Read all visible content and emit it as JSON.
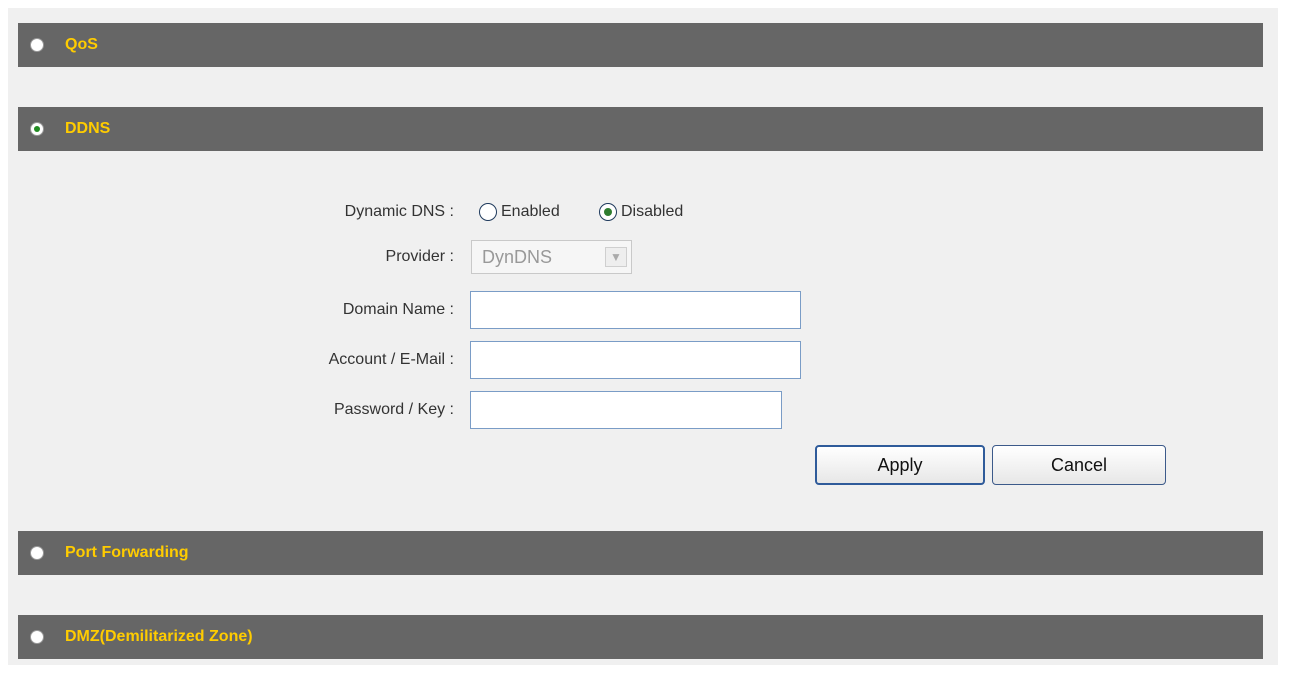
{
  "sections": {
    "qos": {
      "title": "QoS",
      "selected": false
    },
    "ddns": {
      "title": "DDNS",
      "selected": true
    },
    "port_forwarding": {
      "title": "Port Forwarding",
      "selected": false
    },
    "dmz": {
      "title": "DMZ(Demilitarized Zone)",
      "selected": false
    }
  },
  "ddns_form": {
    "dynamic_dns_label": "Dynamic DNS :",
    "enabled_label": "Enabled",
    "disabled_label": "Disabled",
    "dynamic_dns_value": "Disabled",
    "provider_label": "Provider :",
    "provider_value": "DynDNS",
    "domain_name_label": "Domain Name :",
    "domain_name_value": "",
    "account_label": "Account / E-Mail :",
    "account_value": "",
    "password_label": "Password / Key :",
    "password_value": "",
    "apply_label": "Apply",
    "cancel_label": "Cancel"
  },
  "colors": {
    "section_bar": "#666666",
    "section_title": "#ffcc00",
    "panel_bg": "#f0f0f0"
  }
}
